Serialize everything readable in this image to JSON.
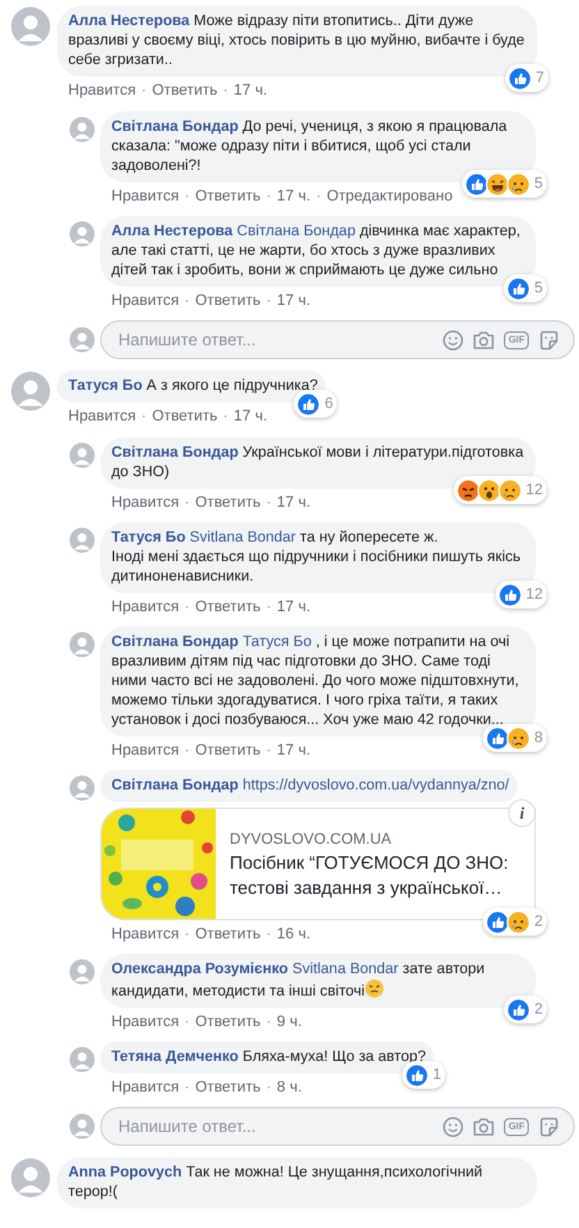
{
  "separator": "·",
  "comments": [
    {
      "author": "Алла Нестерова",
      "text": "Може відразу піти втопитись.. Діти дуже вразливі у своєму віці, хтось повірить в цю муйню, вибачте і буде себе згризати..",
      "actions": [
        "Нравится",
        "Ответить"
      ],
      "time": "17 ч.",
      "reactions": {
        "types": [
          {
            "kind": "like"
          }
        ],
        "count": "7"
      },
      "children": [
        {
          "author": "Світлана Бондар",
          "text": "До речі, учениця, з якою я працювала сказала: \"може одразу піти і вбитися, щоб усі стали задоволені?!",
          "actions": [
            "Нравится",
            "Ответить"
          ],
          "time": "17 ч.",
          "edited": "Отредактировано",
          "reactions": {
            "types": [
              {
                "kind": "like"
              },
              {
                "kind": "haha"
              },
              {
                "kind": "sad"
              }
            ],
            "count": "5"
          }
        },
        {
          "author": "Алла Нестерова",
          "mention": "Світлана Бондар",
          "text": "дівчинка має характер, але такі статті, це не жарти, бо хтось з дуже вразливих дітей так і зробить, вони ж сприймають це дуже сильно",
          "actions": [
            "Нравится",
            "Ответить"
          ],
          "time": "17 ч.",
          "reactions": {
            "types": [
              {
                "kind": "like"
              }
            ],
            "count": "5"
          }
        }
      ],
      "reply_box": {
        "placeholder": "Напишите ответ...",
        "gif": "GIF"
      }
    },
    {
      "author": "Татуся Бо",
      "text": "А з якого це підручника?",
      "actions": [
        "Нравится",
        "Ответить"
      ],
      "time": "17 ч.",
      "reactions": {
        "types": [
          {
            "kind": "like"
          }
        ],
        "count": "6"
      },
      "children": [
        {
          "author": "Світлана Бондар",
          "text": "Української мови і літератури.підготовка до ЗНО)",
          "actions": [
            "Нравится",
            "Ответить"
          ],
          "time": "17 ч.",
          "reactions": {
            "types": [
              {
                "kind": "angry"
              },
              {
                "kind": "wow"
              },
              {
                "kind": "sad"
              }
            ],
            "count": "12"
          }
        },
        {
          "author": "Татуся Бо",
          "mention": "Svitlana Bondar",
          "text": "та ну йопересете ж.\nІноді мені здається що підручники і посібники пишуть якісь дитиноненависники.",
          "actions": [
            "Нравится",
            "Ответить"
          ],
          "time": "17 ч.",
          "reactions": {
            "types": [
              {
                "kind": "like"
              }
            ],
            "count": "12"
          }
        },
        {
          "author": "Світлана Бондар",
          "mention": "Татуся Бо",
          "text": ", і це може потрапити на очі вразливим дітям під час підготовки до ЗНО. Саме тоді ними часто всі не задоволені. До чого може підштовхнути, можемо тільки здогадуватися. І чого гріха таїти, я таких установок і досі позбуваюся... Хоч уже маю 42 годочки...",
          "actions": [
            "Нравится",
            "Ответить"
          ],
          "time": "17 ч.",
          "reactions": {
            "types": [
              {
                "kind": "like"
              },
              {
                "kind": "sad"
              }
            ],
            "count": "8"
          }
        },
        {
          "author": "Світлана Бондар",
          "link": "https://dyvoslovo.com.ua/vydannya/zno/",
          "preview": {
            "kind": "picture",
            "domain": "DYVOSLOVO.COM.UA",
            "title": "Посібник “ГОТУЄМОСЯ ДО ЗНО: тестові завдання з української…",
            "info": "i"
          },
          "actions": [
            "Нравится",
            "Ответить"
          ],
          "time": "16 ч.",
          "reactions": {
            "types": [
              {
                "kind": "like"
              },
              {
                "kind": "sad"
              }
            ],
            "count": "2"
          }
        },
        {
          "author": "Олександра Розумієнко",
          "mention": "Svitlana Bondar",
          "text": "зате автори кандидати, методисти та інші світочі",
          "emoji": {
            "kind": "steam"
          },
          "actions": [
            "Нравится",
            "Ответить"
          ],
          "time": "9 ч.",
          "reactions": {
            "types": [
              {
                "kind": "like"
              }
            ],
            "count": "2"
          }
        },
        {
          "author": "Тетяна Демченко",
          "text": "Бляха-муха! Що за автор?",
          "actions": [
            "Нравится",
            "Ответить"
          ],
          "time": "8 ч.",
          "reactions": {
            "types": [
              {
                "kind": "like"
              }
            ],
            "count": "1"
          }
        }
      ],
      "reply_box": {
        "placeholder": "Напишите ответ...",
        "gif": "GIF"
      }
    },
    {
      "author": "Anna Popovych",
      "text": "Так не можна! Це знущання,психологічний терор!("
    }
  ]
}
